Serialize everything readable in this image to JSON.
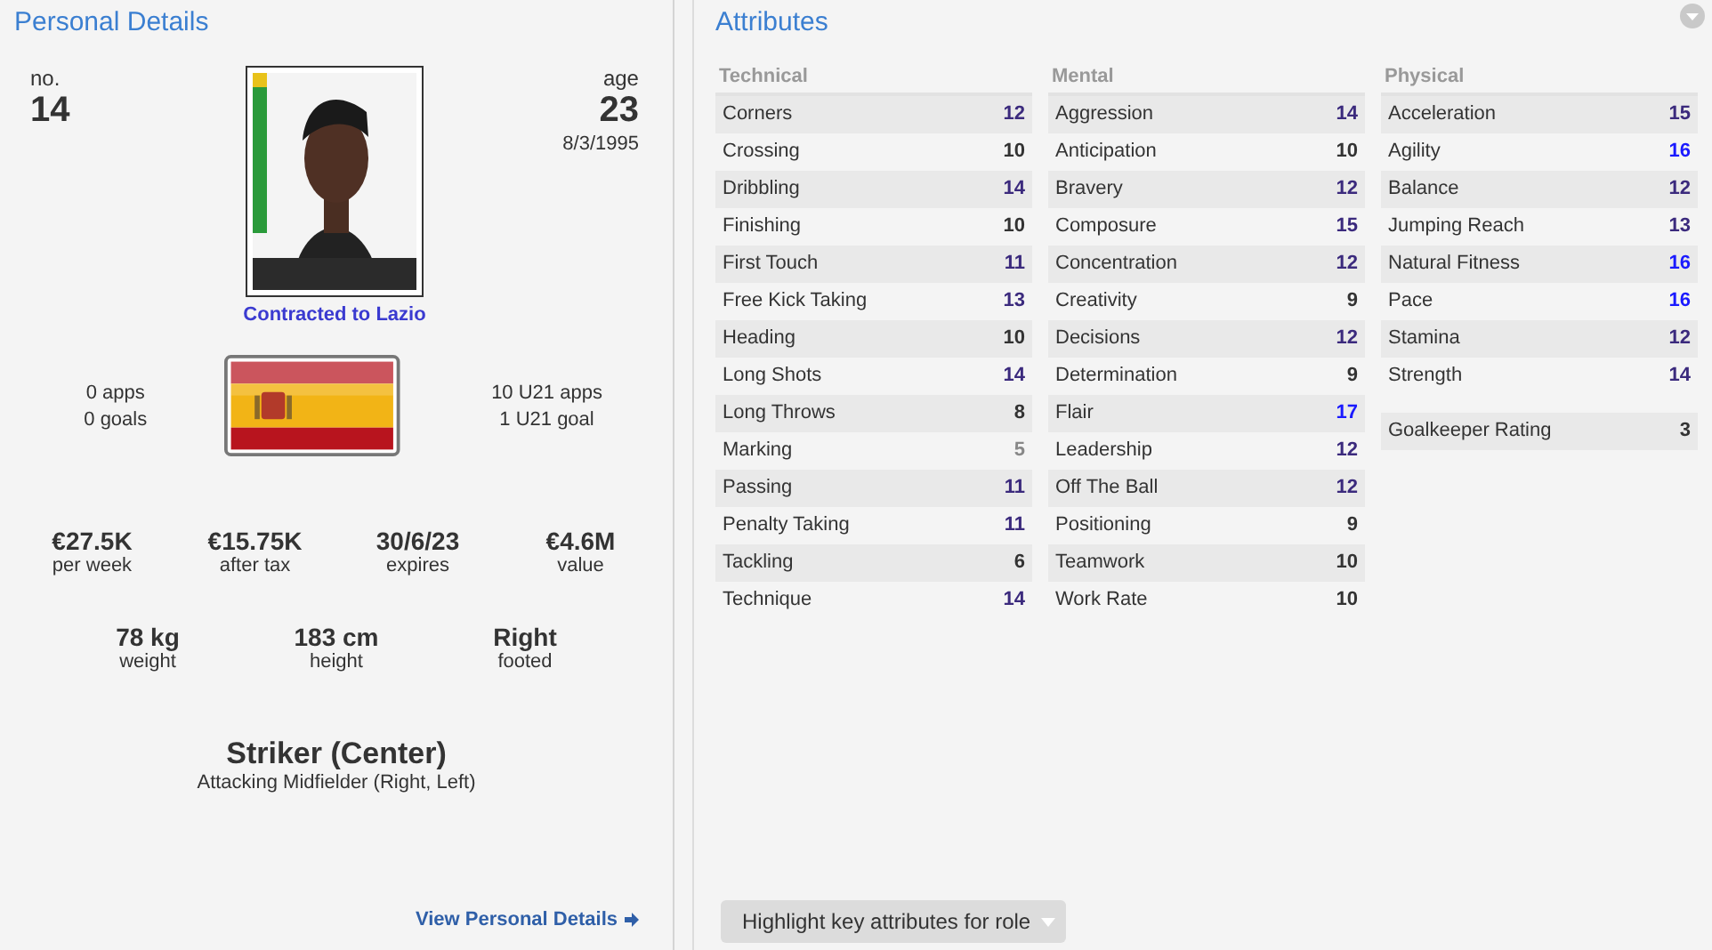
{
  "personal": {
    "title": "Personal Details",
    "number_label": "no.",
    "number": "14",
    "age_label": "age",
    "age": "23",
    "dob": "8/3/1995",
    "contract": "Contracted to Lazio",
    "apps": "0 apps",
    "goals": "0 goals",
    "u21_apps": "10 U21 apps",
    "u21_goals": "1 U21 goal",
    "finances": [
      {
        "value": "€27.5K",
        "label": "per week"
      },
      {
        "value": "€15.75K",
        "label": "after tax"
      },
      {
        "value": "30/6/23",
        "label": "expires"
      },
      {
        "value": "€4.6M",
        "label": "value"
      }
    ],
    "body": [
      {
        "value": "78 kg",
        "label": "weight"
      },
      {
        "value": "183 cm",
        "label": "height"
      },
      {
        "value": "Right",
        "label": "footed"
      }
    ],
    "position": "Striker (Center)",
    "secondary_position": "Attacking Midfielder (Right, Left)",
    "link": "View Personal Details"
  },
  "attributes": {
    "title": "Attributes",
    "groups": [
      {
        "title": "Technical",
        "items": [
          {
            "name": "Corners",
            "value": "12",
            "color": "#3b2a7d"
          },
          {
            "name": "Crossing",
            "value": "10",
            "color": "#333333"
          },
          {
            "name": "Dribbling",
            "value": "14",
            "color": "#3b2a7d"
          },
          {
            "name": "Finishing",
            "value": "10",
            "color": "#333333"
          },
          {
            "name": "First Touch",
            "value": "11",
            "color": "#3b2a7d"
          },
          {
            "name": "Free Kick Taking",
            "value": "13",
            "color": "#3b2a7d"
          },
          {
            "name": "Heading",
            "value": "10",
            "color": "#333333"
          },
          {
            "name": "Long Shots",
            "value": "14",
            "color": "#3b2a7d"
          },
          {
            "name": "Long Throws",
            "value": "8",
            "color": "#333333"
          },
          {
            "name": "Marking",
            "value": "5",
            "color": "#888888"
          },
          {
            "name": "Passing",
            "value": "11",
            "color": "#3b2a7d"
          },
          {
            "name": "Penalty Taking",
            "value": "11",
            "color": "#3b2a7d"
          },
          {
            "name": "Tackling",
            "value": "6",
            "color": "#333333"
          },
          {
            "name": "Technique",
            "value": "14",
            "color": "#3b2a7d"
          }
        ]
      },
      {
        "title": "Mental",
        "items": [
          {
            "name": "Aggression",
            "value": "14",
            "color": "#3b2a7d"
          },
          {
            "name": "Anticipation",
            "value": "10",
            "color": "#333333"
          },
          {
            "name": "Bravery",
            "value": "12",
            "color": "#3b2a7d"
          },
          {
            "name": "Composure",
            "value": "15",
            "color": "#3b2a7d"
          },
          {
            "name": "Concentration",
            "value": "12",
            "color": "#3b2a7d"
          },
          {
            "name": "Creativity",
            "value": "9",
            "color": "#333333"
          },
          {
            "name": "Decisions",
            "value": "12",
            "color": "#3b2a7d"
          },
          {
            "name": "Determination",
            "value": "9",
            "color": "#333333"
          },
          {
            "name": "Flair",
            "value": "17",
            "color": "#1a1aff"
          },
          {
            "name": "Leadership",
            "value": "12",
            "color": "#3b2a7d"
          },
          {
            "name": "Off The Ball",
            "value": "12",
            "color": "#3b2a7d"
          },
          {
            "name": "Positioning",
            "value": "9",
            "color": "#333333"
          },
          {
            "name": "Teamwork",
            "value": "10",
            "color": "#333333"
          },
          {
            "name": "Work Rate",
            "value": "10",
            "color": "#333333"
          }
        ]
      },
      {
        "title": "Physical",
        "items": [
          {
            "name": "Acceleration",
            "value": "15",
            "color": "#3b2a7d"
          },
          {
            "name": "Agility",
            "value": "16",
            "color": "#1a1aff"
          },
          {
            "name": "Balance",
            "value": "12",
            "color": "#3b2a7d"
          },
          {
            "name": "Jumping Reach",
            "value": "13",
            "color": "#3b2a7d"
          },
          {
            "name": "Natural Fitness",
            "value": "16",
            "color": "#1a1aff"
          },
          {
            "name": "Pace",
            "value": "16",
            "color": "#1a1aff"
          },
          {
            "name": "Stamina",
            "value": "12",
            "color": "#3b2a7d"
          },
          {
            "name": "Strength",
            "value": "14",
            "color": "#3b2a7d"
          }
        ]
      }
    ],
    "goalkeeper": {
      "name": "Goalkeeper Rating",
      "value": "3"
    },
    "button": "Highlight key attributes for role"
  }
}
